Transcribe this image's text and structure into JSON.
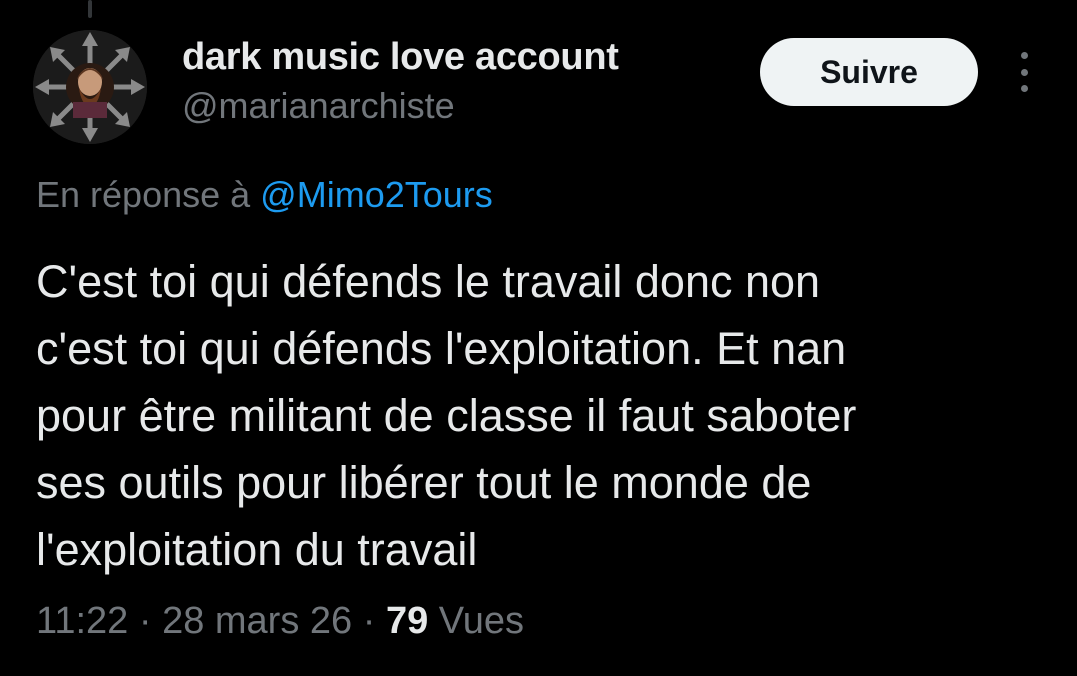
{
  "user": {
    "display_name": "dark music love account",
    "handle": "@marianarchiste",
    "avatar_icon": "chaos-star-portrait-avatar"
  },
  "actions": {
    "follow_label": "Suivre",
    "more_icon": "more-vertical-icon"
  },
  "reply": {
    "prefix": "En réponse à",
    "mention": "@Mimo2Tours"
  },
  "tweet": {
    "lines": [
      "C'est toi qui défends le travail donc non",
      "c'est toi qui défends l'exploitation. Et nan",
      "pour être militant de classe il faut saboter",
      "ses outils pour libérer tout le monde de",
      "l'exploitation du travail"
    ]
  },
  "meta": {
    "time": "11:22",
    "separator": "·",
    "date": "28 mars 26",
    "views_count": "79",
    "views_label": "Vues"
  },
  "colors": {
    "background": "#000000",
    "text": "#e7e9ea",
    "muted": "#71767b",
    "link": "#1d9bf0",
    "button_bg": "#eff3f4"
  }
}
